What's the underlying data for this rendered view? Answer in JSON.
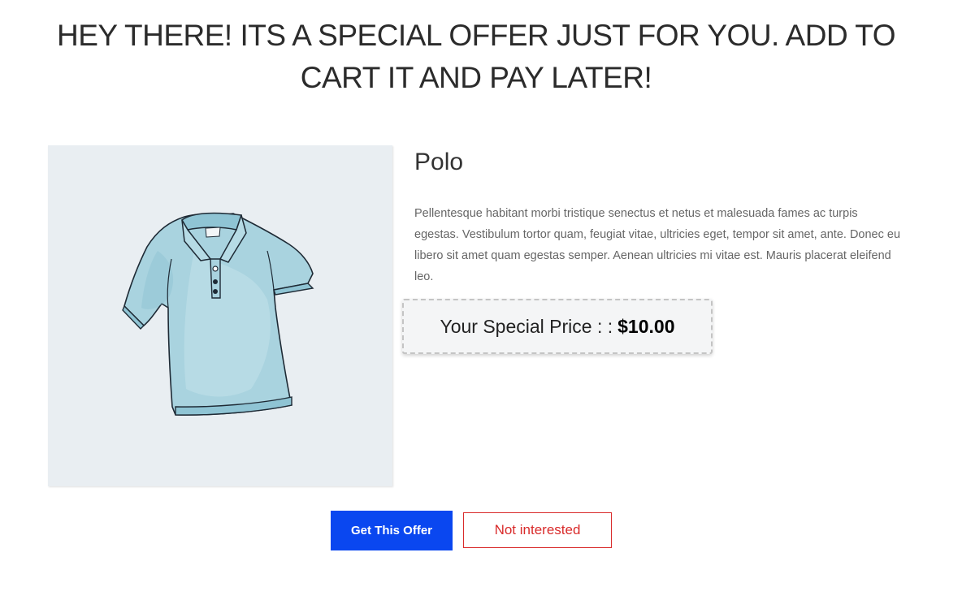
{
  "offer": {
    "headline": "HEY THERE! ITS A SPECIAL OFFER JUST FOR YOU. ADD TO CART IT AND PAY LATER!"
  },
  "product": {
    "title": "Polo",
    "image_icon": "polo-shirt-illustration",
    "description": "Pellentesque habitant morbi tristique senectus et netus et malesuada fames ac turpis egestas. Vestibulum tortor quam, feugiat vitae, ultricies eget, tempor sit amet, ante. Donec eu libero sit amet quam egestas semper. Aenean ultricies mi vitae est. Mauris placerat eleifend leo.",
    "price_label": "Your Special Price : :",
    "price_value": "$10.00"
  },
  "actions": {
    "accept_label": "Get This Offer",
    "decline_label": "Not interested"
  },
  "colors": {
    "accept_bg": "#0a47f0",
    "decline_accent": "#d92b2b",
    "image_bg": "#e9eef2",
    "shirt_fill": "#a9d3df"
  }
}
